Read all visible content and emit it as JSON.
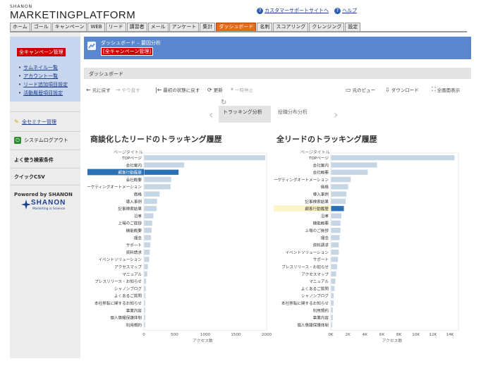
{
  "header": {
    "brand_small": "SHANON",
    "brand": "MARKETINGPLATFORM",
    "support_link": "カスタマーサポートサイトへ",
    "help_link": "ヘルプ"
  },
  "nav": {
    "tabs": [
      {
        "label": "ホーム"
      },
      {
        "label": "ゴール"
      },
      {
        "label": "キャンペーン"
      },
      {
        "label": "WEB"
      },
      {
        "label": "リード"
      },
      {
        "label": "講習者"
      },
      {
        "label": "メール"
      },
      {
        "label": "アンケート"
      },
      {
        "label": "集計"
      },
      {
        "label": "ダッシュボード",
        "active": true
      },
      {
        "label": "名刺"
      },
      {
        "label": "スコアリング"
      },
      {
        "label": "クレンジング"
      },
      {
        "label": "設定"
      }
    ]
  },
  "sidebar": {
    "heading": "全キャンペーン管理",
    "links": [
      "サムネイル一覧",
      "アカウント一覧",
      "リード追加項目設定",
      "活動履歴項目設定"
    ],
    "seminar": "全セミナー管理",
    "logout": "システムログアウト",
    "search": "よく使う検索条件",
    "quick_csv": "クイックCSV",
    "powered": "Powered by SHANON",
    "logo_name": "SHANON",
    "logo_tagline": "Marketing is Science"
  },
  "main": {
    "path": "ダッシュボード – 要因分析",
    "campaign": "[全キャンペーン管理]",
    "section": "ダッシュボード"
  },
  "toolbar": {
    "undo": "元に戻す",
    "redo": "やり直す",
    "revert": "最初の状態に戻す",
    "refresh": "更新",
    "pause": "一時停止",
    "original_view": "元のビュー",
    "download": "ダウンロード",
    "fullscreen": "全画面表示"
  },
  "carousel": {
    "tab1": "トラッキング分析",
    "tab2": "役職分布分析"
  },
  "colors": {
    "bar": "#c7d6e5",
    "bar_highlight": "#2a72b5",
    "title_bar": "#5a86cf",
    "active_tab": "#e26a1a"
  },
  "chart_data": [
    {
      "type": "bar",
      "orientation": "horizontal",
      "title": "商談化したリードのトラッキング履歴",
      "axis_header": "ページタイトル",
      "xlabel": "アクセス数",
      "xlim": [
        0,
        2000
      ],
      "xticks": [
        0,
        500,
        1000,
        1500,
        2000
      ],
      "tick_labels": [
        "0",
        "500",
        "1000",
        "1500",
        "2000"
      ],
      "highlight": "顧客行動履歴",
      "categories": [
        "TOPページ",
        "会社案内",
        "顧客行動履歴",
        "会社概要",
        "マーケティングオートメーション",
        "価格",
        "導入事例",
        "記事検索結果",
        "沿革",
        "上場のご挨拶",
        "機能概要",
        "理念",
        "サポート",
        "資料請求",
        "イベントソリューション",
        "アクセスマップ",
        "マニュアル",
        "プレスリリース・お知らせ",
        "シャノンブログ",
        "よくあるご質問",
        "本社移転に関するお知らせ",
        "事業内容",
        "個人情報保護体制",
        "利用規約"
      ],
      "values": [
        1970,
        650,
        560,
        440,
        430,
        250,
        210,
        200,
        150,
        130,
        120,
        110,
        100,
        90,
        80,
        60,
        50,
        30,
        25,
        20,
        15,
        10,
        8,
        5
      ]
    },
    {
      "type": "bar",
      "orientation": "horizontal",
      "title": "全リードのトラッキング履歴",
      "axis_header": "ページタイトル",
      "xlabel": "アクセス数",
      "xlim": [
        0,
        15000
      ],
      "xticks": [
        0,
        2000,
        4000,
        6000,
        8000,
        10000,
        12000,
        14000
      ],
      "tick_labels": [
        "0K",
        "2K",
        "4K",
        "6K",
        "8K",
        "10K",
        "12K",
        "14K"
      ],
      "highlight": "顧客行動履歴",
      "categories": [
        "TOPページ",
        "会社案内",
        "会社概要",
        "マーケティングオートメーション",
        "価格",
        "導入事例",
        "記事検索結果",
        "顧客行動履歴",
        "沿革",
        "機能概要",
        "上場のご挨拶",
        "理念",
        "資料請求",
        "イベントソリューション",
        "サポート",
        "プレスリリース・お知らせ",
        "アクセスマップ",
        "マニュアル",
        "よくあるご質問",
        "シャノンブログ",
        "本社移転に関するお知らせ",
        "利用規約",
        "事業内容",
        "個人情報保護体制"
      ],
      "values": [
        14500,
        5400,
        4300,
        2300,
        2000,
        1800,
        1700,
        1500,
        1200,
        1100,
        1100,
        1000,
        900,
        900,
        800,
        700,
        600,
        500,
        400,
        300,
        300,
        200,
        200,
        100
      ]
    }
  ]
}
